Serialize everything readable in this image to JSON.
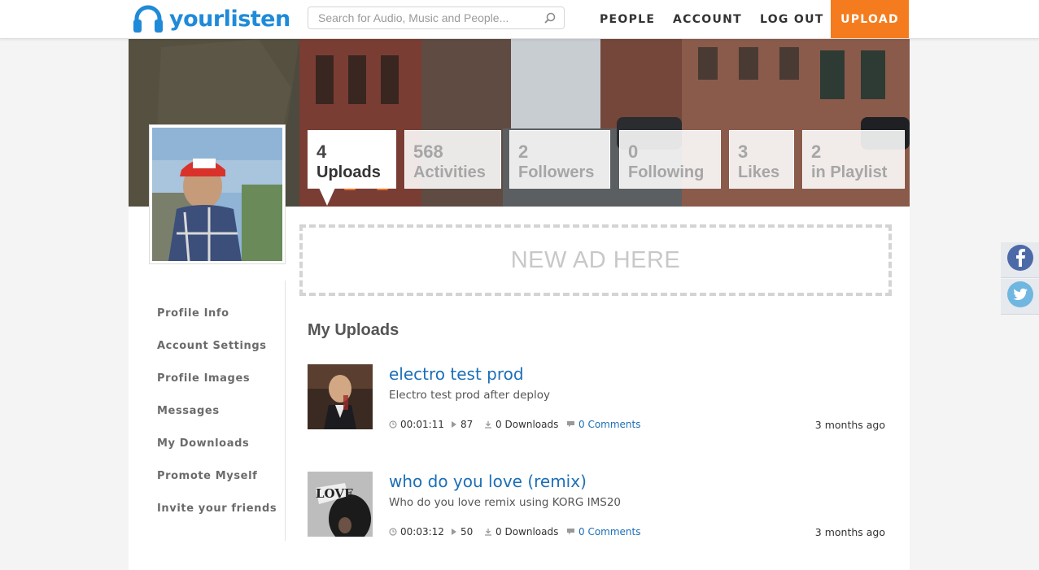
{
  "header": {
    "logo_text": "yourlisten",
    "search_placeholder": "Search for Audio, Music and People...",
    "nav": {
      "people": "PEOPLE",
      "account": "ACCOUNT",
      "logout": "LOG OUT",
      "upload": "UPLOAD"
    },
    "colors": {
      "brand": "#1f8ad8",
      "upload_button": "#f57c1e"
    }
  },
  "profile": {
    "stats": [
      {
        "num": "4",
        "label": "Uploads",
        "active": true
      },
      {
        "num": "568",
        "label": "Activities"
      },
      {
        "num": "2",
        "label": "Followers"
      },
      {
        "num": "0",
        "label": "Following"
      },
      {
        "num": "3",
        "label": "Likes"
      },
      {
        "num": "2",
        "label": "in Playlist"
      }
    ]
  },
  "ad": {
    "text": "NEW AD HERE"
  },
  "sidebar": {
    "items": [
      {
        "label": "Profile Info"
      },
      {
        "label": "Account Settings"
      },
      {
        "label": "Profile Images"
      },
      {
        "label": "Messages"
      },
      {
        "label": "My Downloads"
      },
      {
        "label": "Promote Myself"
      },
      {
        "label": "Invite your friends"
      }
    ]
  },
  "uploads": {
    "title": "My Uploads",
    "items": [
      {
        "title": "electro test prod",
        "description": "Electro test prod after deploy",
        "duration": "00:01:11",
        "plays": "87",
        "downloads": "0 Downloads",
        "comments": "0 Comments",
        "ago": "3 months ago"
      },
      {
        "title": "who do you love (remix)",
        "description": "Who do you love remix using KORG IMS20",
        "duration": "00:03:12",
        "plays": "50",
        "downloads": "0 Downloads",
        "comments": "0 Comments",
        "ago": "3 months ago",
        "thumb_text": "LOVE"
      }
    ]
  },
  "social": {
    "icons": [
      "facebook-icon",
      "twitter-icon"
    ]
  }
}
